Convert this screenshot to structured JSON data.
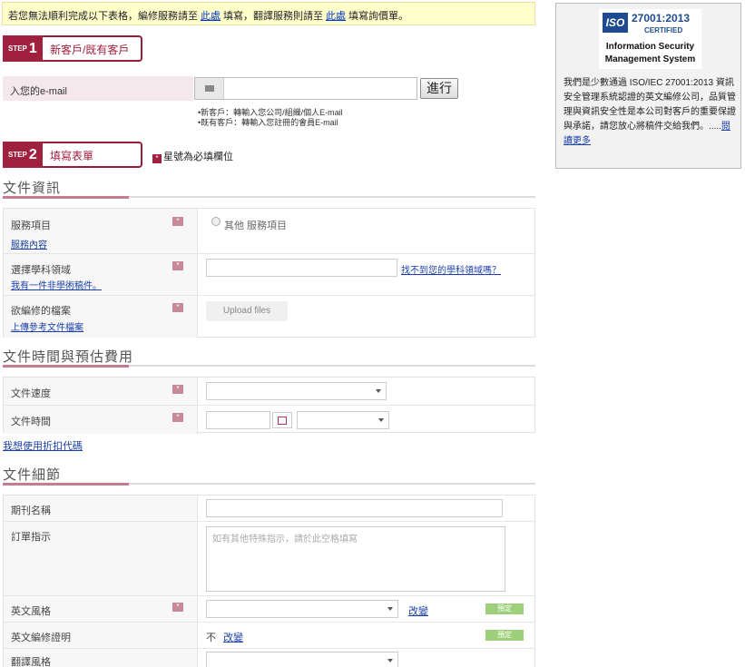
{
  "notice": {
    "part1": "若您無法順利完成以下表格，編修服務請至",
    "link1": "此處",
    "part2": "填寫，翻譯服務則請至",
    "link2": "此處",
    "part3": "填寫詢價單。"
  },
  "step1": {
    "tag": "STEP",
    "num": "1",
    "label": "新客戶/既有客戶"
  },
  "email": {
    "label": "入您的e-mail",
    "placeholder": "",
    "button": "進行",
    "hint_new": "•新客戶：轉輸入您公司/組織/個人E-mail",
    "hint_existing": "•既有客戶：轉輸入您註冊的會員E-mail"
  },
  "step2": {
    "tag": "STEP",
    "num": "2",
    "label": "填寫表單"
  },
  "required_note": {
    "icon": "*",
    "text": "星號為必填欄位"
  },
  "sec_doc": {
    "title": "文件資訊",
    "service": {
      "label": "服務項目",
      "sub": "服務內容",
      "option": "其他 服務項目"
    },
    "subject": {
      "label": "選擇學科領域",
      "sub": "我有一件非學術稿件。",
      "link": "找不到您的學科領域嗎？"
    },
    "files": {
      "label": "欲編修的檔案",
      "sub": "上傳參考文件檔案",
      "button": "Upload files"
    }
  },
  "sec_time": {
    "title": "文件時間與預估費用",
    "speed": {
      "label": "文件速度"
    },
    "time": {
      "label": "文件時間"
    },
    "discount_link": "我想使用折扣代碼"
  },
  "sec_detail": {
    "title": "文件細節",
    "journal": {
      "label": "期刊名稱"
    },
    "instructions": {
      "label": "訂單指示",
      "placeholder": "如有其他特殊指示，請於此空格填寫"
    },
    "style": {
      "label": "英文風格",
      "change": "改變",
      "badge": "預定"
    },
    "edit_note": {
      "label": "英文編修證明",
      "value": "不",
      "change": "改變",
      "badge": "預定"
    },
    "translate_style": {
      "label": "翻譯風格"
    }
  },
  "sidebar": {
    "iso_logo": "ISO",
    "iso_num": "27001:2013",
    "certified": "CERTIFIED",
    "line1": "Information Security",
    "line2": "Management System",
    "body": "我們是少數通過 ISO/IEC 27001:2013 資訊安全管理系統認證的英文編修公司，品質管理與資訊安全性是本公司對客戶的重要保證與承諾，請您放心將稿件交給我們。.....",
    "more": "閱讀更多"
  }
}
